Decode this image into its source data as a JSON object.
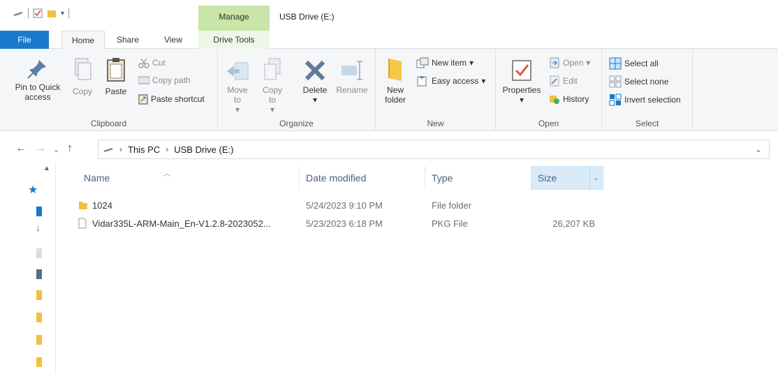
{
  "title": "USB Drive (E:)",
  "manage_label": "Manage",
  "tabs": {
    "file": "File",
    "home": "Home",
    "share": "Share",
    "view": "View",
    "drive_tools": "Drive Tools"
  },
  "ribbon": {
    "clipboard": {
      "pin": "Pin to Quick access",
      "copy": "Copy",
      "paste": "Paste",
      "cut": "Cut",
      "copy_path": "Copy path",
      "paste_shortcut": "Paste shortcut",
      "label": "Clipboard"
    },
    "organize": {
      "move_to": "Move to",
      "copy_to": "Copy to",
      "delete": "Delete",
      "rename": "Rename",
      "label": "Organize"
    },
    "new": {
      "new_folder": "New folder",
      "new_item": "New item",
      "easy_access": "Easy access",
      "label": "New"
    },
    "open": {
      "properties": "Properties",
      "open": "Open",
      "edit": "Edit",
      "history": "History",
      "label": "Open"
    },
    "select": {
      "select_all": "Select all",
      "select_none": "Select none",
      "invert": "Invert selection",
      "label": "Select"
    }
  },
  "address": {
    "this_pc": "This PC",
    "drive": "USB Drive (E:)"
  },
  "columns": {
    "name": "Name",
    "date": "Date modified",
    "type": "Type",
    "size": "Size"
  },
  "files": [
    {
      "name": "1024",
      "date": "5/24/2023 9:10 PM",
      "type": "File folder",
      "size": ""
    },
    {
      "name": "Vidar335L-ARM-Main_En-V1.2.8-2023052...",
      "date": "5/23/2023 6:18 PM",
      "type": "PKG File",
      "size": "26,207 KB"
    }
  ],
  "colors": {
    "file_tab": "#1979ca",
    "manage": "#c8e6a8",
    "folder": "#f0c040",
    "size_header": "#d9ebf9"
  }
}
